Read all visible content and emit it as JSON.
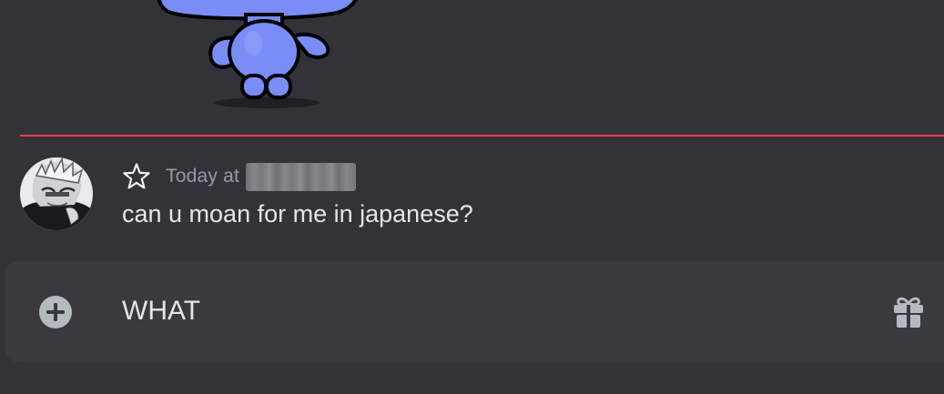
{
  "mascot": {
    "icon": "wumpus-mascot-icon",
    "color": "#7a8cf7"
  },
  "divider": {
    "color": "#f23f43"
  },
  "message": {
    "avatar_icon": "user-avatar-icon",
    "badge_icon": "star-outline-icon",
    "timestamp_prefix": "Today at",
    "content": "can u moan for me in japanese?"
  },
  "composer": {
    "attach_icon": "plus-circle-icon",
    "value": "WHAT",
    "gift_icon": "gift-icon"
  },
  "theme": {
    "background": "#313338",
    "composer_background": "#383a40",
    "muted_text": "#949ba4",
    "text": "#e3e5e8"
  }
}
